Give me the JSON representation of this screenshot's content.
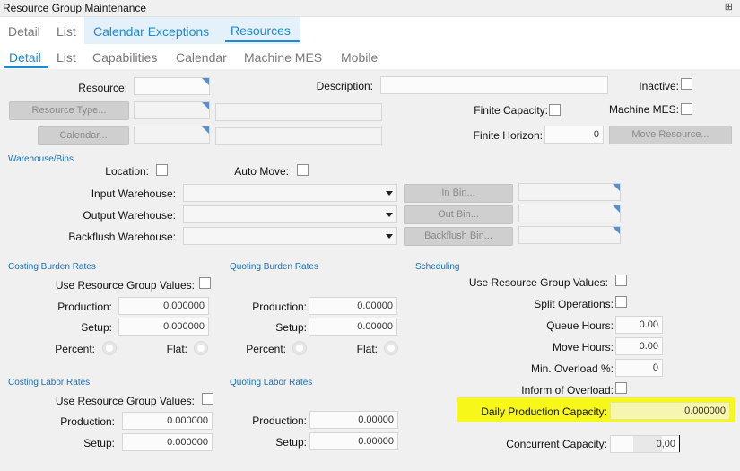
{
  "window": {
    "title": "Resource Group Maintenance",
    "pin_glyph": "⊞"
  },
  "tabs_top": [
    {
      "label": "Detail"
    },
    {
      "label": "List"
    },
    {
      "label": "Calendar Exceptions"
    },
    {
      "label": "Resources"
    }
  ],
  "tabs_sub": [
    {
      "label": "Detail"
    },
    {
      "label": "List"
    },
    {
      "label": "Capabilities"
    },
    {
      "label": "Calendar"
    },
    {
      "label": "Machine MES"
    },
    {
      "label": "Mobile"
    }
  ],
  "header": {
    "resource_label": "Resource:",
    "description_label": "Description:",
    "inactive_label": "Inactive:",
    "resource_type_button": "Resource Type...",
    "finite_capacity_label": "Finite Capacity:",
    "machine_mes_label": "Machine MES:",
    "calendar_button": "Calendar...",
    "finite_horizon_label": "Finite Horizon:",
    "finite_horizon_value": "0",
    "move_resource_button": "Move Resource..."
  },
  "warehouse": {
    "section_title": "Warehouse/Bins",
    "location_label": "Location:",
    "auto_move_label": "Auto Move:",
    "input_label": "Input Warehouse:",
    "output_label": "Output Warehouse:",
    "backflush_label": "Backflush Warehouse:",
    "in_bin_button": "In Bin...",
    "out_bin_button": "Out Bin...",
    "backflush_bin_button": "Backflush Bin..."
  },
  "costing_burden": {
    "section_title": "Costing Burden Rates",
    "use_group_label": "Use Resource Group Values:",
    "production_label": "Production:",
    "production_value": "0.000000",
    "setup_label": "Setup:",
    "setup_value": "0.000000",
    "percent_label": "Percent:",
    "flat_label": "Flat:"
  },
  "quoting_burden": {
    "section_title": "Quoting Burden Rates",
    "production_label": "Production:",
    "production_value": "0.00000",
    "setup_label": "Setup:",
    "setup_value": "0.00000",
    "percent_label": "Percent:",
    "flat_label": "Flat:"
  },
  "scheduling": {
    "section_title": "Scheduling",
    "use_group_label": "Use Resource Group Values:",
    "split_ops_label": "Split Operations:",
    "queue_hours_label": "Queue Hours:",
    "queue_hours_value": "0.00",
    "move_hours_label": "Move Hours:",
    "move_hours_value": "0.00",
    "min_overload_label": "Min. Overload %:",
    "min_overload_value": "0",
    "inform_overload_label": "Inform of Overload:",
    "daily_capacity_label": "Daily Production Capacity:",
    "daily_capacity_value": "0.000000",
    "concurrent_label": "Concurrent Capacity:",
    "concurrent_value": "0,00"
  },
  "costing_labor": {
    "section_title": "Costing Labor Rates",
    "use_group_label": "Use Resource Group Values:",
    "production_label": "Production:",
    "production_value": "0.000000",
    "setup_label": "Setup:",
    "setup_value": "0.000000"
  },
  "quoting_labor": {
    "section_title": "Quoting Labor Rates",
    "production_label": "Production:",
    "production_value": "0.00000",
    "setup_label": "Setup:",
    "setup_value": "0.00000"
  },
  "colors": {
    "accent": "#1a8ad4",
    "highlight": "#f7f719",
    "section_title": "#1a6fb0"
  }
}
